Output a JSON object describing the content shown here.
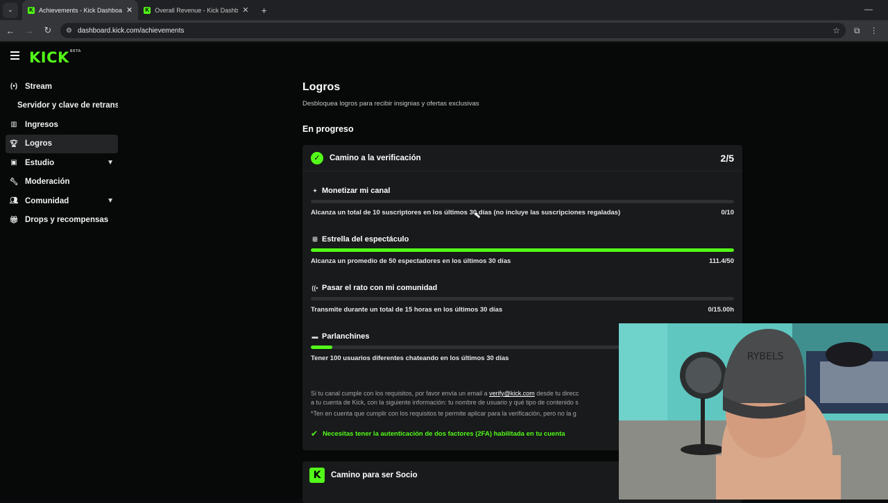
{
  "browser": {
    "tabs": [
      {
        "title": "Achievements - Kick Dashboard",
        "active": true
      },
      {
        "title": "Overall Revenue - Kick Dashboar",
        "active": false
      }
    ],
    "url": "dashboard.kick.com/achievements"
  },
  "app": {
    "logo": "KICK",
    "logo_badge": "BETA"
  },
  "sidebar": {
    "items": [
      {
        "label": "Stream",
        "icon": "broadcast-icon"
      },
      {
        "label": "Servidor y clave de retransm",
        "icon": ""
      },
      {
        "label": "Ingresos",
        "icon": "chart-icon"
      },
      {
        "label": "Logros",
        "icon": "trophy-icon",
        "active": true
      },
      {
        "label": "Estudio",
        "icon": "studio-icon",
        "expandable": true
      },
      {
        "label": "Moderación",
        "icon": "wrench-icon"
      },
      {
        "label": "Comunidad",
        "icon": "users-icon",
        "expandable": true
      },
      {
        "label": "Drops y recompensas",
        "icon": "gift-icon"
      }
    ]
  },
  "main": {
    "title": "Logros",
    "subtitle": "Desbloquea logros para recibir insignias y ofertas exclusivas",
    "section": "En progreso",
    "card": {
      "title": "Camino a la verificación",
      "count": "2/5",
      "achievements": [
        {
          "title": "Monetizar mi canal",
          "icon": "sparkle-icon",
          "desc": "Alcanza un total de 10 suscriptores en los últimos 30 días (no incluye las suscripciones regaladas)",
          "value": "0/10",
          "progress": 0.0
        },
        {
          "title": "Estrella del espectáculo",
          "icon": "viewers-icon",
          "desc": "Alcanza un promedio de 50 espectadores en los últimos 30 días",
          "value": "111.4/50",
          "progress": 1.0
        },
        {
          "title": "Pasar el rato con mi comunidad",
          "icon": "broadcast-icon",
          "desc": "Transmite durante un total de 15 horas en los últimos 30 días",
          "value": "0/15.00h",
          "progress": 0.0
        },
        {
          "title": "Parlanchines",
          "icon": "chat-icon",
          "desc": "Tener 100 usuarios diferentes chateando en los últimos 30 días",
          "value": "",
          "progress": 0.05
        }
      ],
      "note_line1_pre": "Si tu canal cumple con los requisitos, por favor envía un email a ",
      "note_link": "verify@kick.com",
      "note_line1_post": " desde tu direcc",
      "note_line2": "a tu cuenta de Kick, con la siguiente información: tu nombre de usuario y qué tipo de contenido s",
      "note_line3": "*Ten en cuenta que cumplir con los requisitos te permite aplicar para la verificación, pero no la g",
      "twofa": "Necesitas tener la autenticación de dos factores (2FA) habilitada en tu cuenta"
    },
    "card2": {
      "title": "Camino para ser Socio",
      "badge": "K"
    }
  },
  "colors": {
    "accent": "#53fc18",
    "background": "#070808",
    "card": "#181a1b"
  }
}
